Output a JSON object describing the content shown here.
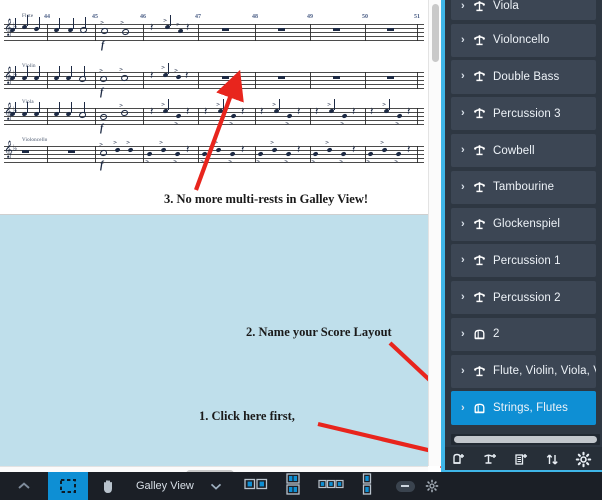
{
  "app": {
    "accent_color": "#0e8fd4",
    "panel_border_color": "#3fb6e8",
    "panel_bg": "#2e3742",
    "row_bg": "#3c4654",
    "canvas_bg": "#bfdfeb",
    "annotation_color": "#e8251d"
  },
  "score": {
    "systems": [
      {
        "instrument": "Flute",
        "measure_numbers": [
          "44",
          "45",
          "46",
          "47",
          "48",
          "49",
          "50",
          "51"
        ],
        "dynamic": "f"
      },
      {
        "instrument": "Violin",
        "dynamic": "f"
      },
      {
        "instrument": "Viola",
        "dynamic": "f"
      },
      {
        "instrument": "Violoncello",
        "dynamic": "f"
      }
    ]
  },
  "annotations": [
    {
      "id": "anno-1",
      "text": "1. Click here first,"
    },
    {
      "id": "anno-2",
      "text": "2. Name your Score Layout"
    },
    {
      "id": "anno-3",
      "text": "3. No more multi-rests in Galley View!"
    }
  ],
  "panel": {
    "rows": [
      {
        "label": "Viola",
        "icon": "player-icon",
        "selected": false
      },
      {
        "label": "Violoncello",
        "icon": "player-icon",
        "selected": false
      },
      {
        "label": "Double Bass",
        "icon": "player-icon",
        "selected": false
      },
      {
        "label": "Percussion 3",
        "icon": "player-icon",
        "selected": false
      },
      {
        "label": "Cowbell",
        "icon": "player-icon",
        "selected": false
      },
      {
        "label": "Tambourine",
        "icon": "player-icon",
        "selected": false
      },
      {
        "label": "Glockenspiel",
        "icon": "player-icon",
        "selected": false
      },
      {
        "label": "Percussion 1",
        "icon": "player-icon",
        "selected": false
      },
      {
        "label": "Percussion 2",
        "icon": "player-icon",
        "selected": false
      },
      {
        "label": "2",
        "icon": "layout-icon",
        "selected": false
      },
      {
        "label": "Flute, Violin, Viola, Vio",
        "icon": "player-icon",
        "selected": false
      },
      {
        "label": "Strings, Flutes",
        "icon": "layout-icon",
        "selected": true
      }
    ],
    "toolbar": [
      {
        "name": "add-layout-button",
        "icon": "layout-plus-icon"
      },
      {
        "name": "add-player-button",
        "icon": "player-plus-icon"
      },
      {
        "name": "add-flow-button",
        "icon": "flow-plus-icon"
      },
      {
        "name": "sort-button",
        "icon": "sort-arrows-icon"
      },
      {
        "name": "options-button",
        "icon": "gear-icon"
      }
    ]
  },
  "statusbar": {
    "collapse_icon": "chevron-up-icon",
    "marquee_tool": "marquee-select-icon",
    "hand_tool": "hand-icon",
    "view_mode": "Galley View",
    "view_mode_caret": "chevron-down-icon",
    "layout_buttons": [
      {
        "name": "page-spread-view-button",
        "icon": "two-page-icon"
      },
      {
        "name": "page-grid-view-button",
        "icon": "four-page-icon"
      },
      {
        "name": "page-row-view-button",
        "icon": "three-page-icon"
      },
      {
        "name": "page-column-view-button",
        "icon": "two-stacked-page-icon"
      }
    ],
    "zoom_out_label": "−"
  }
}
